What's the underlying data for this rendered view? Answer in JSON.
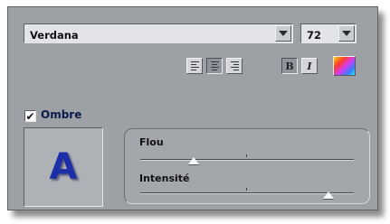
{
  "font": {
    "selected": "Verdana",
    "size": "72"
  },
  "toolbar": {
    "align_left_selected": false,
    "align_center_selected": true,
    "align_right_selected": false,
    "bold_label": "B",
    "italic_label": "I",
    "bold_selected": true
  },
  "shadow": {
    "checkbox_mark": "✔",
    "label": "Ombre",
    "checked": true,
    "preview_letter": "A",
    "sliders": [
      {
        "label": "Flou",
        "value_fraction": 0.25
      },
      {
        "label": "Intensité",
        "value_fraction": 0.88
      }
    ]
  },
  "colors": {
    "frame": "#9da1a6",
    "preview_text": "#1d2fa8"
  }
}
